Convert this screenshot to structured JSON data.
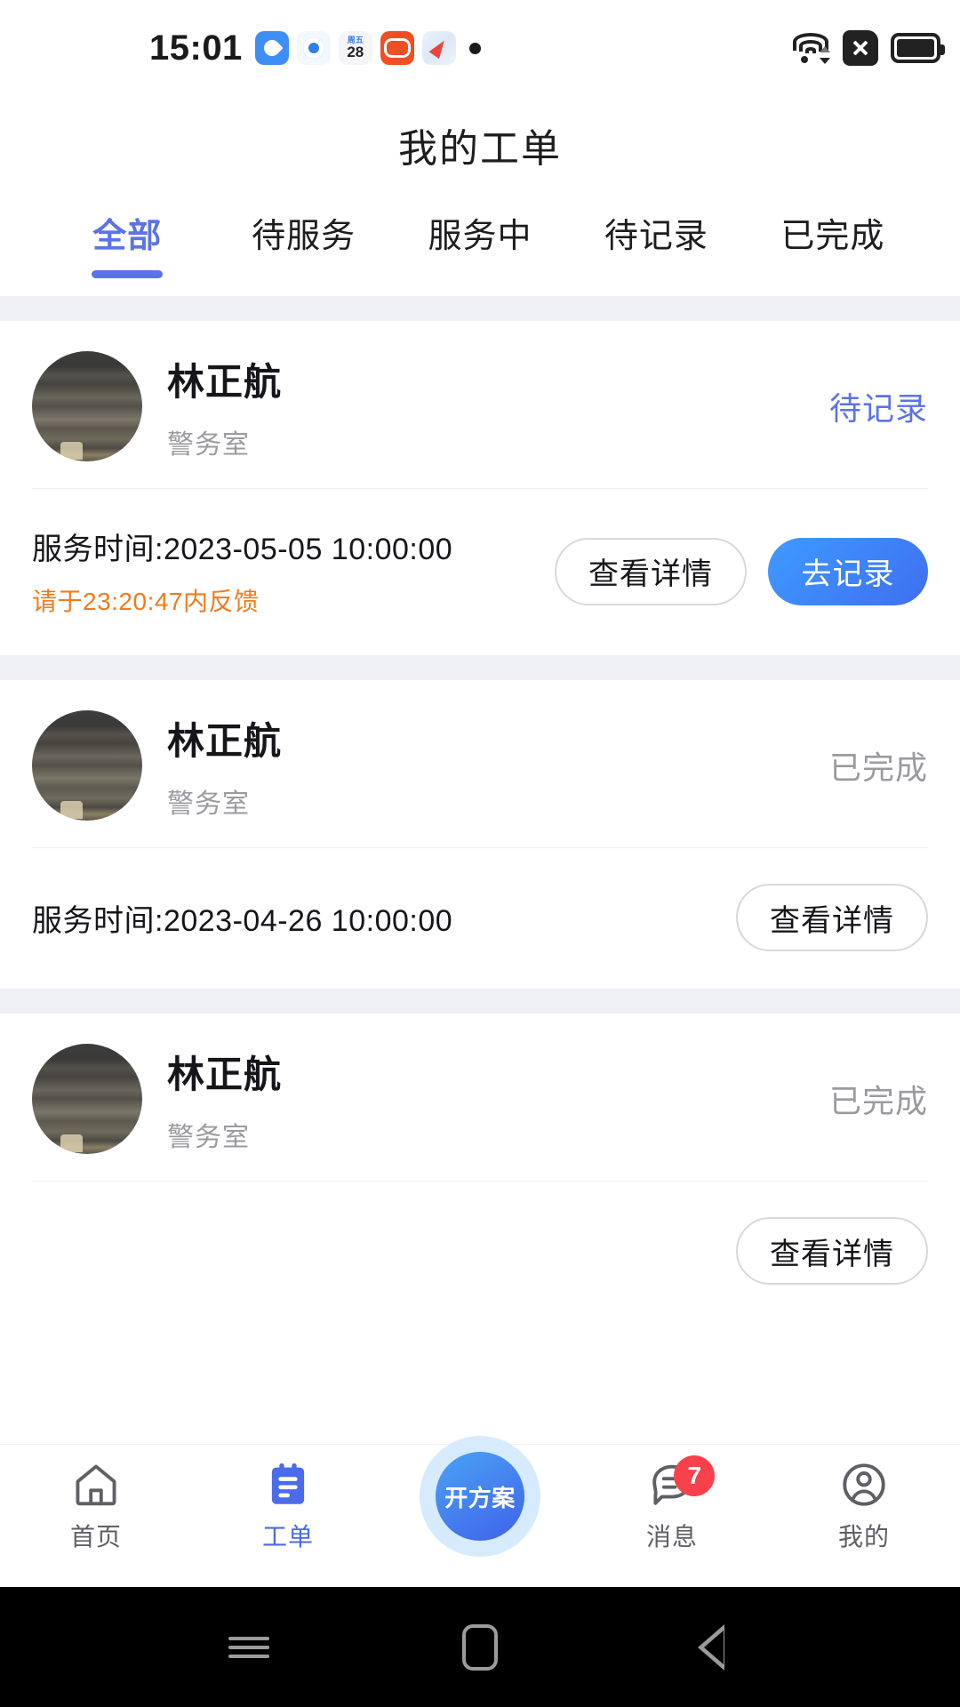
{
  "statusbar": {
    "time": "15:01",
    "calendar_icon": {
      "weekday": "周五",
      "day": "28"
    },
    "icons_left": [
      "water-drop-app-icon",
      "ring-app-icon",
      "calendar-app-icon",
      "camera-app-icon",
      "compass-app-icon",
      "dot-indicator-icon"
    ],
    "icons_right": [
      "wifi-icon",
      "no-sim-icon",
      "battery-icon"
    ]
  },
  "header": {
    "title": "我的工单"
  },
  "tabs": {
    "items": [
      {
        "label": "全部",
        "active": true
      },
      {
        "label": "待服务",
        "active": false
      },
      {
        "label": "服务中",
        "active": false
      },
      {
        "label": "待记录",
        "active": false
      },
      {
        "label": "已完成",
        "active": false
      }
    ],
    "active_color": "#5b73e8"
  },
  "orders": [
    {
      "name": "林正航",
      "dept": "警务室",
      "status": "待记录",
      "status_type": "pending",
      "service_time": "服务时间:2023-05-05 10:00:00",
      "warning": "请于23:20:47内反馈",
      "buttons": {
        "detail": "查看详情",
        "action": "去记录"
      }
    },
    {
      "name": "林正航",
      "dept": "警务室",
      "status": "已完成",
      "status_type": "done",
      "service_time": "服务时间:2023-04-26 10:00:00",
      "warning": "",
      "buttons": {
        "detail": "查看详情",
        "action": ""
      }
    },
    {
      "name": "林正航",
      "dept": "警务室",
      "status": "已完成",
      "status_type": "done",
      "service_time": "",
      "warning": "",
      "buttons": {
        "detail": "查看详情",
        "action": ""
      }
    }
  ],
  "tabbar": {
    "items": [
      {
        "label": "首页",
        "icon": "home-icon",
        "active": false
      },
      {
        "label": "工单",
        "icon": "clipboard-icon",
        "active": true
      },
      {
        "label": "开方案",
        "icon": "fab-plan-icon",
        "active": false
      },
      {
        "label": "消息",
        "icon": "message-icon",
        "active": false,
        "badge": "7"
      },
      {
        "label": "我的",
        "icon": "person-icon",
        "active": false
      }
    ],
    "fab_label": "开方案",
    "badge_count": "7",
    "active_color": "#4a6bea",
    "badge_color": "#f8414a"
  },
  "androidnav": {
    "buttons": [
      "menu-icon",
      "home-square-icon",
      "back-triangle-icon"
    ]
  },
  "colors": {
    "accent": "#5b73e8",
    "primary_button": "#3f6ef0",
    "warning": "#f07b1d",
    "muted": "#9a9a9f",
    "page_bg": "#eef0f5"
  }
}
